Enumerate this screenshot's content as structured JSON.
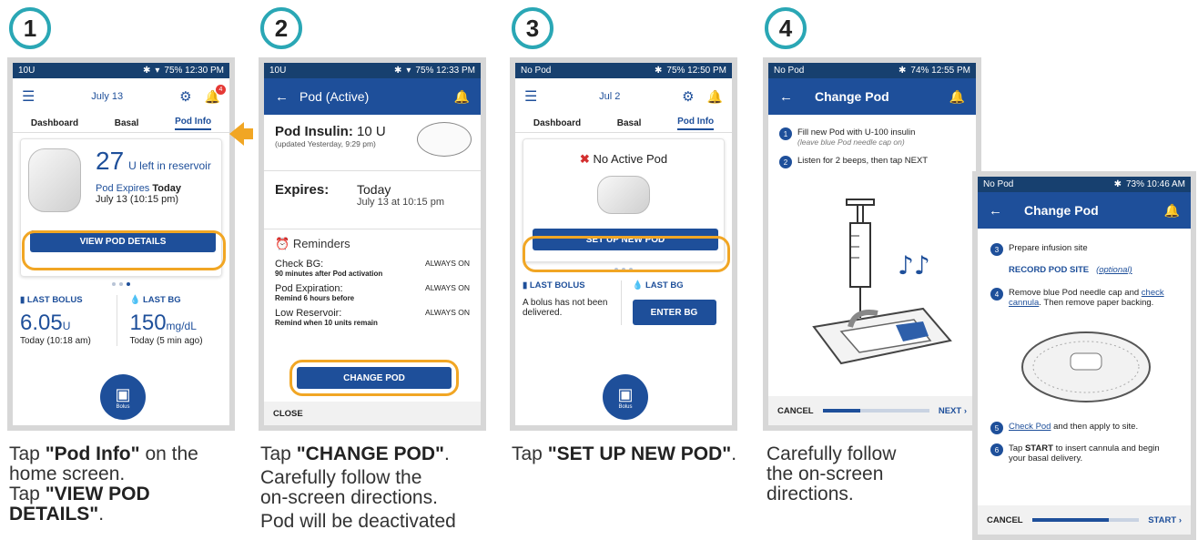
{
  "colors": {
    "navy": "#17406f",
    "blue": "#1e4f9a",
    "teal": "#2aa7b5",
    "orange": "#f1a624"
  },
  "steps": [
    {
      "number": "1",
      "caption_lines": [
        [
          "Tap ",
          "\"Pod Info\"",
          " on the"
        ],
        [
          "home screen."
        ],
        [
          "Tap ",
          "\"VIEW POD"
        ],
        [
          "",
          "DETAILS\"",
          "."
        ]
      ]
    },
    {
      "number": "2",
      "caption_lines": [
        [
          "Tap ",
          "\"CHANGE POD\"",
          "."
        ],
        [
          "Carefully follow the"
        ],
        [
          "on-screen directions."
        ],
        [
          "Pod will be deactivated"
        ]
      ]
    },
    {
      "number": "3",
      "caption_lines": [
        [
          "Tap ",
          "\"SET UP NEW POD\"",
          "."
        ]
      ]
    },
    {
      "number": "4",
      "caption_lines": [
        [
          "Carefully follow"
        ],
        [
          "the on-screen"
        ],
        [
          "directions."
        ]
      ]
    }
  ],
  "screen1": {
    "status_left": "10U",
    "status_right": "75%  12:30 PM",
    "date": "July 13",
    "badge": "4",
    "tabs": [
      "Dashboard",
      "Basal",
      "Pod Info"
    ],
    "units": "27",
    "units_label": "U left in reservoir",
    "expires_prefix": "Pod Expires",
    "expires_bold": "Today",
    "expires_time": "July 13 (10:15 pm)",
    "view_button": "VIEW POD DETAILS",
    "last_bolus_label": "LAST BOLUS",
    "last_bolus_value": "6.05",
    "last_bolus_unit": "U",
    "last_bolus_time": "Today (10:18 am)",
    "last_bg_label": "LAST BG",
    "last_bg_value": "150",
    "last_bg_unit": "mg/dL",
    "last_bg_time": "Today (5 min ago)",
    "bolus_label": "Bolus"
  },
  "screen2": {
    "status_left": "10U",
    "status_right": "75%  12:33 PM",
    "title": "Pod (Active)",
    "pod_insulin_label": "Pod Insulin:",
    "pod_insulin_value": "10 U",
    "updated": "(updated Yesterday, 9:29 pm)",
    "expires_label": "Expires:",
    "expires_day": "Today",
    "expires_time": "July 13 at 10:15 pm",
    "reminders_title": "Reminders",
    "reminders": [
      {
        "name": "Check BG:",
        "status": "ALWAYS ON",
        "desc": "90 minutes after Pod activation"
      },
      {
        "name": "Pod Expiration:",
        "status": "ALWAYS ON",
        "desc": "Remind 6 hours before"
      },
      {
        "name": "Low Reservoir:",
        "status": "ALWAYS ON",
        "desc": "Remind when 10 units remain"
      }
    ],
    "change_button": "CHANGE POD",
    "close": "CLOSE"
  },
  "screen3": {
    "status_left": "No Pod",
    "status_right": "75%  12:50 PM",
    "date": "Jul 2",
    "tabs": [
      "Dashboard",
      "Basal",
      "Pod Info"
    ],
    "no_pod": "No Active Pod",
    "setup_button": "SET UP NEW POD",
    "last_bolus_label": "LAST BOLUS",
    "last_bolus_text": "A bolus has not been delivered.",
    "last_bg_label": "LAST BG",
    "enter_bg": "ENTER BG",
    "bolus_label": "Bolus"
  },
  "screen4": {
    "status_left": "No Pod",
    "status_right": "74%  12:55 PM",
    "title": "Change Pod",
    "steps": [
      {
        "n": "1",
        "text": "Fill new Pod with U-100 insulin",
        "sub": "(leave blue Pod needle cap on)"
      },
      {
        "n": "2",
        "text": "Listen for 2 beeps, then tap NEXT",
        "sub": ""
      }
    ],
    "cancel": "CANCEL",
    "next": "NEXT",
    "progress": 0.35
  },
  "screen5": {
    "status_left": "No Pod",
    "status_right": "73%  10:46 AM",
    "title": "Change Pod",
    "step3": "Prepare infusion site",
    "record": "RECORD POD SITE",
    "optional": "(optional)",
    "step4a": "Remove blue Pod needle cap and",
    "step4link": "check cannula",
    "step4b": ". Then remove paper backing.",
    "step5link": "Check Pod",
    "step5": " and then apply to site.",
    "step6a": "Tap ",
    "step6bold": "START",
    "step6b": " to insert cannula and begin your basal delivery.",
    "cancel": "CANCEL",
    "start": "START",
    "progress": 0.72
  }
}
